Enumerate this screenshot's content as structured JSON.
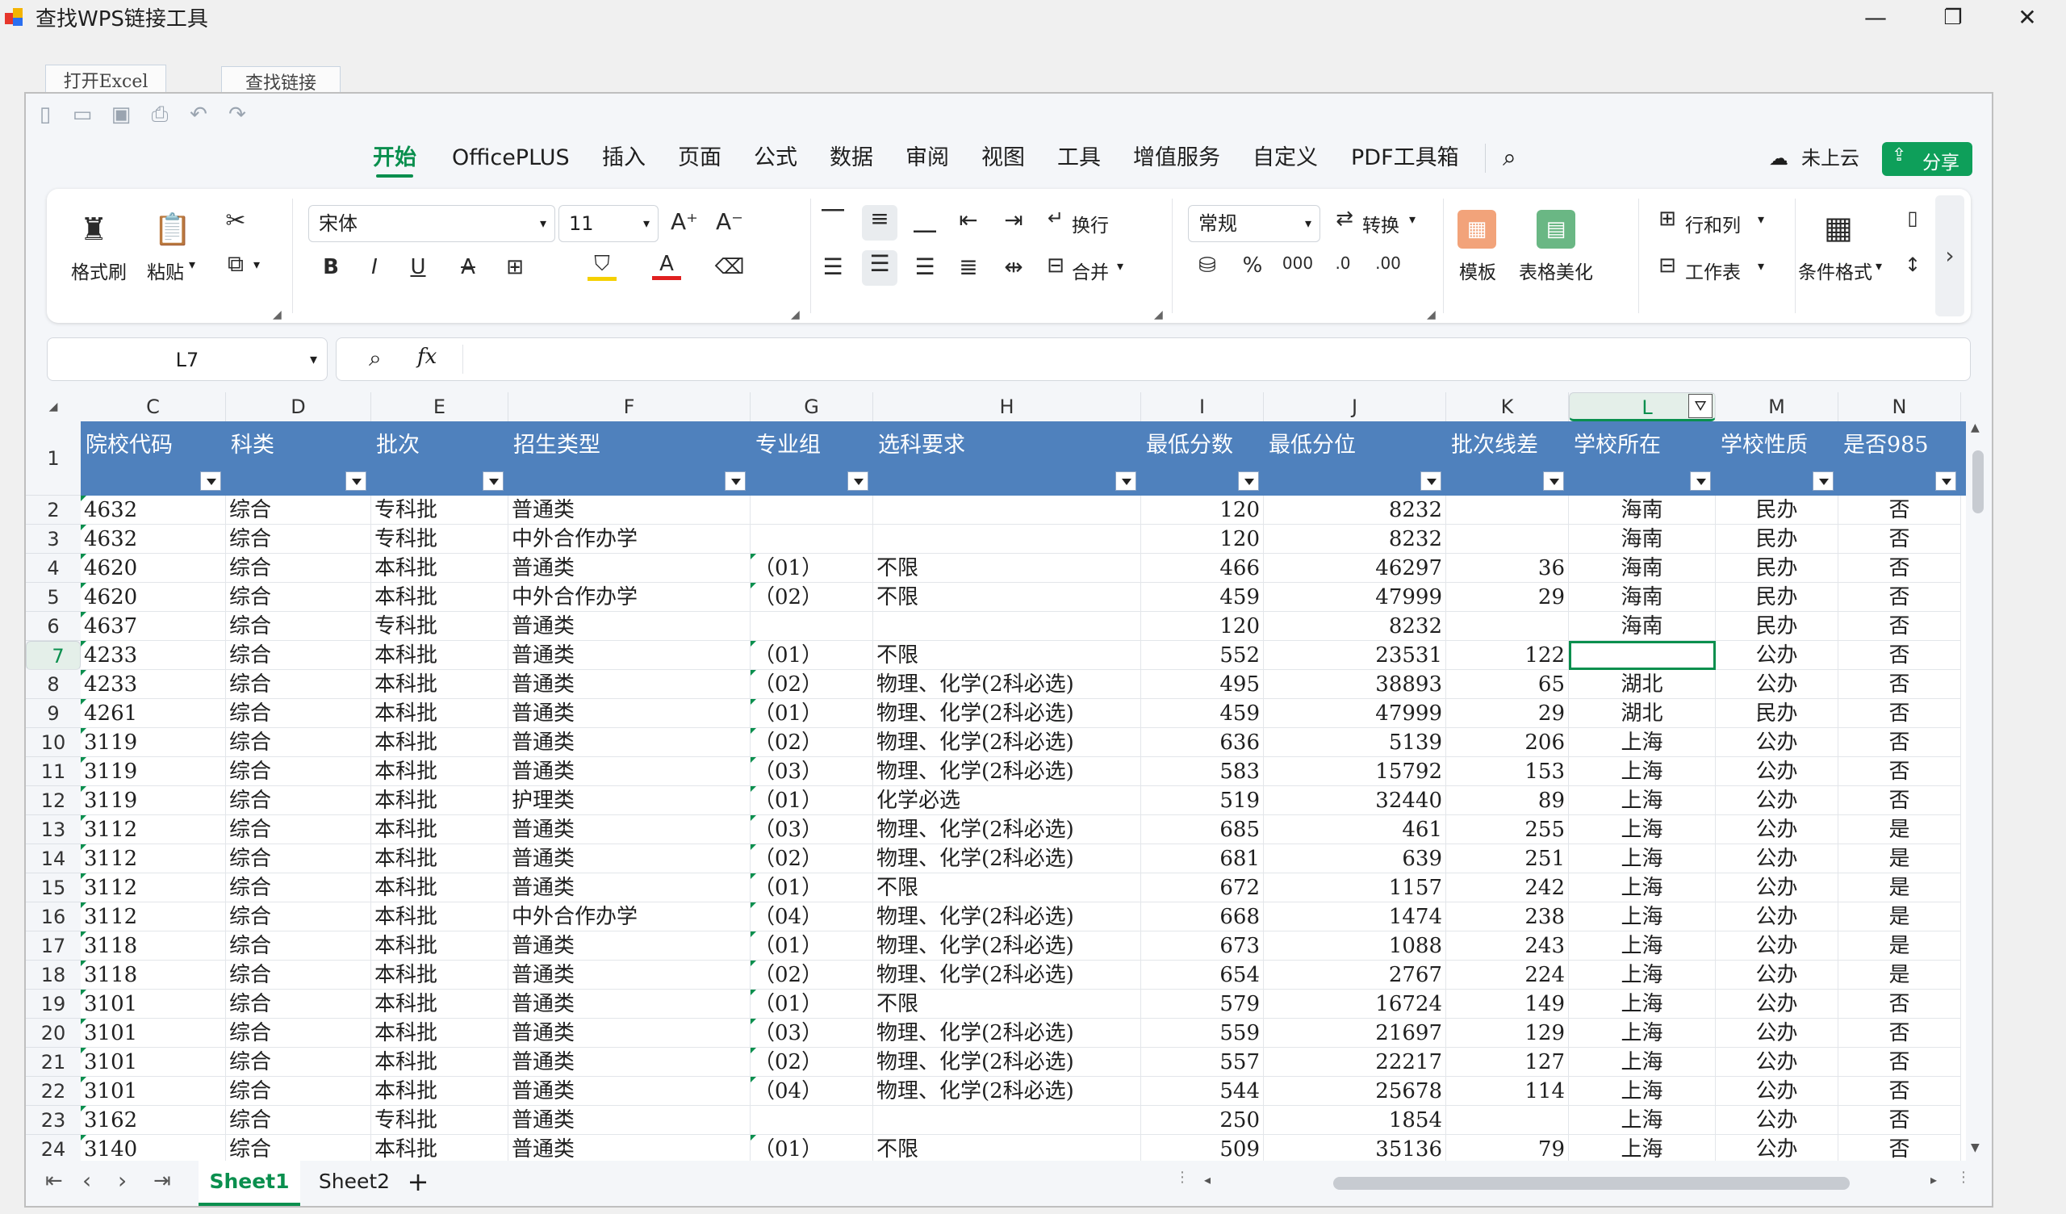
{
  "window": {
    "title": "查找WPS链接工具",
    "minimize": "—",
    "maximize": "❐",
    "close": "✕"
  },
  "outer_buttons": {
    "open_excel": "打开Excel",
    "find_links": "查找链接"
  },
  "menu": {
    "tabs": [
      "开始",
      "OfficePLUS",
      "插入",
      "页面",
      "公式",
      "数据",
      "审阅",
      "视图",
      "工具",
      "增值服务",
      "自定义",
      "PDF工具箱"
    ],
    "active": "开始",
    "cloud_label": "未上云",
    "share_label": "分享"
  },
  "ribbon": {
    "format_painter": "格式刷",
    "paste": "粘贴",
    "font_name": "宋体",
    "font_size": "11",
    "wrap_text": "换行",
    "merge": "合并",
    "number_format": "常规",
    "convert": "转换",
    "template": "模板",
    "table_beautify": "表格美化",
    "rows_cols": "行和列",
    "worksheet": "工作表",
    "cond_format": "条件格式"
  },
  "formula_bar": {
    "cell_ref": "L7",
    "fx": "fx",
    "value": ""
  },
  "columns": [
    "C",
    "D",
    "E",
    "F",
    "G",
    "H",
    "I",
    "J",
    "K",
    "L",
    "M",
    "N"
  ],
  "selected_column": "L",
  "selected_row": "7",
  "header_row_number": "1",
  "headers": [
    "院校代码",
    "科类",
    "批次",
    "招生类型",
    "专业组",
    "选科要求",
    "最低分数",
    "最低分位",
    "批次线差",
    "学校所在",
    "学校性质",
    "是否985"
  ],
  "rows": [
    {
      "n": "2",
      "c": [
        "4632",
        "综合",
        "专科批",
        "普通类",
        "",
        "",
        "120",
        "8232",
        "",
        "海南",
        "民办",
        "否"
      ]
    },
    {
      "n": "3",
      "c": [
        "4632",
        "综合",
        "专科批",
        "中外合作办学",
        "",
        "",
        "120",
        "8232",
        "",
        "海南",
        "民办",
        "否"
      ]
    },
    {
      "n": "4",
      "c": [
        "4620",
        "综合",
        "本科批",
        "普通类",
        "（01）",
        "不限",
        "466",
        "46297",
        "36",
        "海南",
        "民办",
        "否"
      ]
    },
    {
      "n": "5",
      "c": [
        "4620",
        "综合",
        "本科批",
        "中外合作办学",
        "（02）",
        "不限",
        "459",
        "47999",
        "29",
        "海南",
        "民办",
        "否"
      ]
    },
    {
      "n": "6",
      "c": [
        "4637",
        "综合",
        "专科批",
        "普通类",
        "",
        "",
        "120",
        "8232",
        "",
        "海南",
        "民办",
        "否"
      ]
    },
    {
      "n": "7",
      "c": [
        "4233",
        "综合",
        "本科批",
        "普通类",
        "（01）",
        "不限",
        "552",
        "23531",
        "122",
        "",
        "公办",
        "否"
      ]
    },
    {
      "n": "8",
      "c": [
        "4233",
        "综合",
        "本科批",
        "普通类",
        "（02）",
        "物理、化学(2科必选)",
        "495",
        "38893",
        "65",
        "湖北",
        "公办",
        "否"
      ]
    },
    {
      "n": "9",
      "c": [
        "4261",
        "综合",
        "本科批",
        "普通类",
        "（01）",
        "物理、化学(2科必选)",
        "459",
        "47999",
        "29",
        "湖北",
        "民办",
        "否"
      ]
    },
    {
      "n": "10",
      "c": [
        "3119",
        "综合",
        "本科批",
        "普通类",
        "（02）",
        "物理、化学(2科必选)",
        "636",
        "5139",
        "206",
        "上海",
        "公办",
        "否"
      ]
    },
    {
      "n": "11",
      "c": [
        "3119",
        "综合",
        "本科批",
        "普通类",
        "（03）",
        "物理、化学(2科必选)",
        "583",
        "15792",
        "153",
        "上海",
        "公办",
        "否"
      ]
    },
    {
      "n": "12",
      "c": [
        "3119",
        "综合",
        "本科批",
        "护理类",
        "（01）",
        "化学必选",
        "519",
        "32440",
        "89",
        "上海",
        "公办",
        "否"
      ]
    },
    {
      "n": "13",
      "c": [
        "3112",
        "综合",
        "本科批",
        "普通类",
        "（03）",
        "物理、化学(2科必选)",
        "685",
        "461",
        "255",
        "上海",
        "公办",
        "是"
      ]
    },
    {
      "n": "14",
      "c": [
        "3112",
        "综合",
        "本科批",
        "普通类",
        "（02）",
        "物理、化学(2科必选)",
        "681",
        "639",
        "251",
        "上海",
        "公办",
        "是"
      ]
    },
    {
      "n": "15",
      "c": [
        "3112",
        "综合",
        "本科批",
        "普通类",
        "（01）",
        "不限",
        "672",
        "1157",
        "242",
        "上海",
        "公办",
        "是"
      ]
    },
    {
      "n": "16",
      "c": [
        "3112",
        "综合",
        "本科批",
        "中外合作办学",
        "（04）",
        "物理、化学(2科必选)",
        "668",
        "1474",
        "238",
        "上海",
        "公办",
        "是"
      ]
    },
    {
      "n": "17",
      "c": [
        "3118",
        "综合",
        "本科批",
        "普通类",
        "（01）",
        "物理、化学(2科必选)",
        "673",
        "1088",
        "243",
        "上海",
        "公办",
        "是"
      ]
    },
    {
      "n": "18",
      "c": [
        "3118",
        "综合",
        "本科批",
        "普通类",
        "（02）",
        "物理、化学(2科必选)",
        "654",
        "2767",
        "224",
        "上海",
        "公办",
        "是"
      ]
    },
    {
      "n": "19",
      "c": [
        "3101",
        "综合",
        "本科批",
        "普通类",
        "（01）",
        "不限",
        "579",
        "16724",
        "149",
        "上海",
        "公办",
        "否"
      ]
    },
    {
      "n": "20",
      "c": [
        "3101",
        "综合",
        "本科批",
        "普通类",
        "（03）",
        "物理、化学(2科必选)",
        "559",
        "21697",
        "129",
        "上海",
        "公办",
        "否"
      ]
    },
    {
      "n": "21",
      "c": [
        "3101",
        "综合",
        "本科批",
        "普通类",
        "（02）",
        "物理、化学(2科必选)",
        "557",
        "22217",
        "127",
        "上海",
        "公办",
        "否"
      ]
    },
    {
      "n": "22",
      "c": [
        "3101",
        "综合",
        "本科批",
        "普通类",
        "（04）",
        "物理、化学(2科必选)",
        "544",
        "25678",
        "114",
        "上海",
        "公办",
        "否"
      ]
    },
    {
      "n": "23",
      "c": [
        "3162",
        "综合",
        "专科批",
        "普通类",
        "",
        "",
        "250",
        "1854",
        "",
        "上海",
        "公办",
        "否"
      ]
    },
    {
      "n": "24",
      "c": [
        "3140",
        "综合",
        "本科批",
        "普通类",
        "（01）",
        "不限",
        "509",
        "35136",
        "79",
        "上海",
        "公办",
        "否"
      ]
    }
  ],
  "sheets": {
    "tabs": [
      "Sheet1",
      "Sheet2"
    ],
    "active": "Sheet1",
    "add": "+"
  },
  "colors": {
    "accent": "#0a8f4e",
    "header_fill": "#4f81bd"
  }
}
